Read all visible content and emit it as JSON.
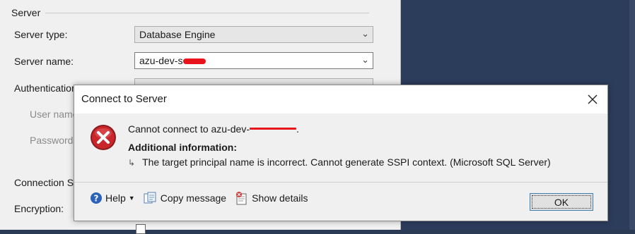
{
  "background": {
    "group_title": "Server",
    "server_type_label": "Server type:",
    "server_type_value": "Database Engine",
    "server_name_label": "Server name:",
    "server_name_value": "azu-dev-s",
    "authentication_label": "Authentication",
    "user_name_label": "User name",
    "password_label": "Password:",
    "connection_security_label": "Connection Se",
    "encryption_label": "Encryption:"
  },
  "dialog": {
    "title": "Connect to Server",
    "message": "Cannot connect to azu-dev-",
    "message_tail": ".",
    "additional_info_heading": "Additional information:",
    "detail": "The target principal name is incorrect.  Cannot generate SSPI context. (Microsoft SQL Server)",
    "help_label": "Help",
    "copy_message_label": "Copy message",
    "show_details_label": "Show details",
    "ok_label": "OK"
  },
  "icons": {
    "close": "close-icon",
    "error": "error-icon",
    "help": "help-icon",
    "copy": "copy-icon",
    "details": "details-icon",
    "arrow": "child-arrow-icon"
  },
  "colors": {
    "error_red": "#c8262b",
    "redaction": "#e8131b",
    "desktop": "#2c3d5c",
    "focus_border": "#3c7fb1"
  }
}
